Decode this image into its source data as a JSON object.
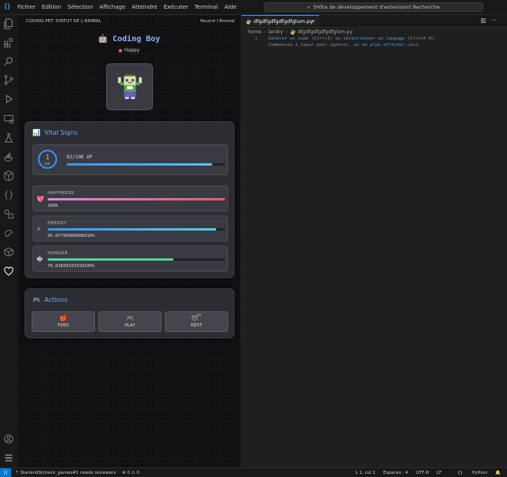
{
  "menu": [
    "Fichier",
    "Edition",
    "Sélection",
    "Affichage",
    "Atteindre",
    "Exécuter",
    "Terminal",
    "Aide"
  ],
  "command_center": "[Hôte de développement d'extension] Recherche",
  "sidebar": {
    "title": "CODING PET: STATUT DE L'ANIMAL",
    "action": "Nourrir l'Animal"
  },
  "pet": {
    "name": "Coding Boy",
    "mood": "Happy"
  },
  "vitals": {
    "title": "Vital Signs",
    "level": "1",
    "level_label": "LVL",
    "xp_text": "92/100 XP",
    "xp_fraction": 0.92,
    "stats": [
      {
        "label": "HAPPINESS",
        "value": "100%",
        "fraction": 1.0,
        "icon": "heart-icon"
      },
      {
        "label": "ENERGY",
        "value": "95.07790000000016%",
        "fraction": 0.9508,
        "icon": "lightning-icon"
      },
      {
        "label": "HUNGER",
        "value": "70.81843333333345%",
        "fraction": 0.7082,
        "icon": "unknown-glyph-icon"
      }
    ]
  },
  "actions": {
    "title": "Actions",
    "buttons": [
      {
        "label": "FEED",
        "icon": "apple-icon"
      },
      {
        "label": "PLAY",
        "icon": "gamepad-icon"
      },
      {
        "label": "REST",
        "icon": "sleepy-face-icon"
      }
    ]
  },
  "editor": {
    "tab": "dfgdfgdfgdfgdfglum.py",
    "breadcrumbs": [
      "home",
      "landry",
      "dfgdfgdfgdfgdfglum.py"
    ],
    "line_number": "1",
    "hint_line1": {
      "a": "Générer un code",
      "b": " (Ctrl+I) ou ",
      "c": "sélectionner un langage",
      "d": " (Ctrl+K M)."
    },
    "hint_line2": {
      "a": "Commencez à taper pour ignorer, ou ",
      "b": "ne plus afficher",
      "c": " ceci."
    }
  },
  "status": {
    "branch": "Starland9/check_games#1 needs reviewers",
    "problems": "⊗ 0 ⚠ 0",
    "position": "L 1, col 1",
    "spaces": "Espaces : 4",
    "encoding": "UTF-8",
    "eol": "LF",
    "language": "Python"
  },
  "colors": {
    "accent": "#3794ff",
    "xp_bar": "#4fc3f7",
    "happiness_bar": "#e55a6f",
    "energy_bar": "#4dd0e1",
    "hunger_bar": "#4cd69a"
  }
}
